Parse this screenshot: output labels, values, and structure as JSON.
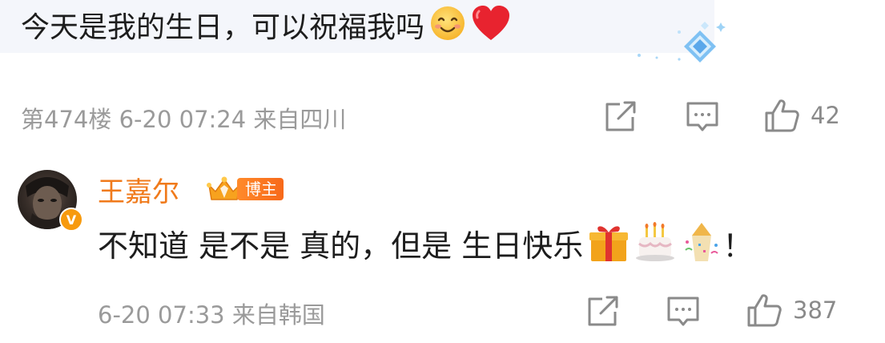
{
  "parent_comment": {
    "text": "今天是我的生日，可以祝福我吗",
    "emojis": [
      "smiling-face-emoji",
      "red-heart-emoji"
    ],
    "floor": "第474楼",
    "date": "6-20",
    "time": "07:24",
    "location": "来自四川",
    "like_count": "42"
  },
  "reply": {
    "username": "王嘉尔",
    "badge_label": "博主",
    "verified_mark": "V",
    "text": "不知道 是不是 真的，但是 生日快乐",
    "emojis": [
      "gift-emoji",
      "cake-emoji",
      "confetti-emoji"
    ],
    "text_suffix": "！",
    "date": "6-20",
    "time": "07:33",
    "location": "来自韩国",
    "like_count": "387"
  },
  "colors": {
    "username": "#f07a1b",
    "meta": "#9a9a9a",
    "bubble_bg": "#f4f6fb",
    "verified_badge": "#f79a0e"
  }
}
